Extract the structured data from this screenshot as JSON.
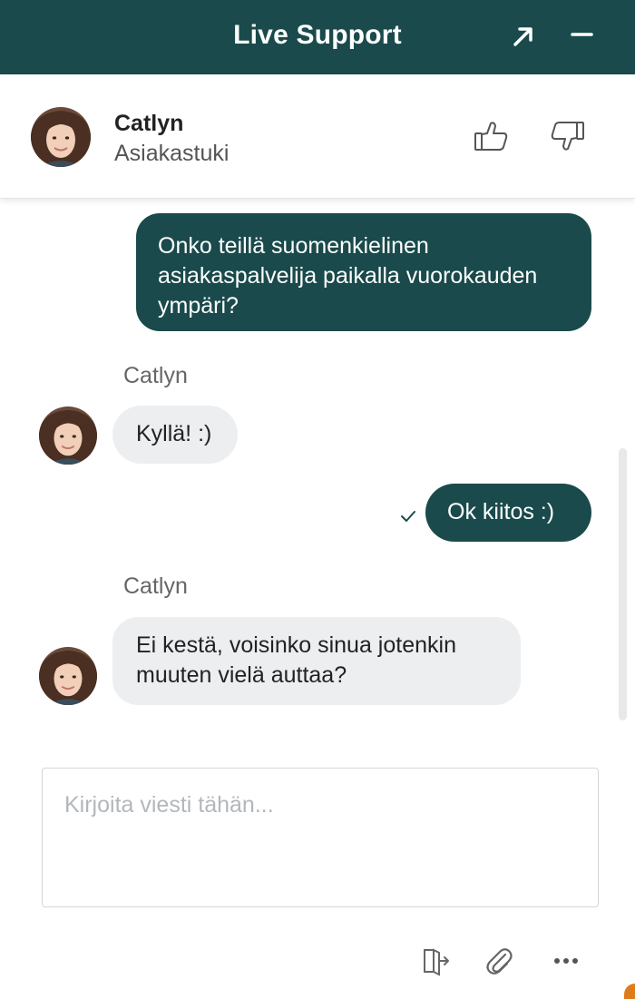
{
  "header": {
    "title": "Live Support",
    "expand_icon": "arrow-up-right-icon",
    "minimize_icon": "minus-icon",
    "bg_color": "#1a4a4b"
  },
  "agent": {
    "name": "Catlyn",
    "role": "Asiakastuki",
    "rating_icons": [
      "thumbs-up-icon",
      "thumbs-down-icon"
    ]
  },
  "messages": [
    {
      "from": "user",
      "text": "Onko teillä suomenkielinen asiakaspalvelija paikalla vuorokauden ympäri?"
    },
    {
      "from": "agent",
      "author": "Catlyn",
      "text": "Kyllä! :)"
    },
    {
      "from": "user",
      "text": "Ok kiitos :)",
      "status_icon": "check-icon"
    },
    {
      "from": "agent",
      "author": "Catlyn",
      "text": "Ei kestä, voisinko sinua jotenkin muuten vielä auttaa?"
    }
  ],
  "composer": {
    "placeholder": "Kirjoita viesti tähän...",
    "value": ""
  },
  "toolbar": {
    "icons": [
      "exit-icon",
      "paperclip-icon",
      "more-icon"
    ]
  },
  "colors": {
    "accent": "#1a4a4b",
    "agent_bubble": "#eceef0"
  }
}
